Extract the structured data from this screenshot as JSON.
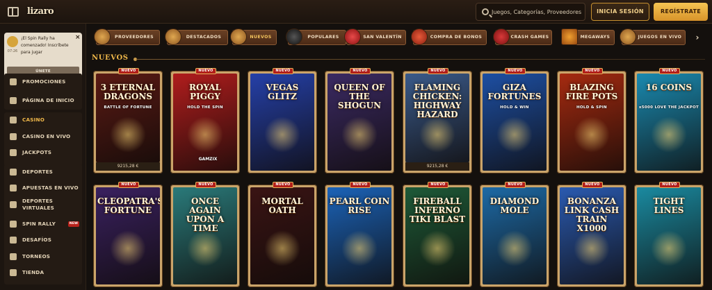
{
  "header": {
    "logo": "lizaro",
    "search_placeholder": "Juegos, Categorías, Proveedores",
    "login_label": "INICIA SESIÓN",
    "register_label": "REGÍSTRATE"
  },
  "notification": {
    "text": "¡El Spin Rally ha comenzado! Inscríbete para jugar",
    "time": "07:26",
    "button": "ÚNETE"
  },
  "sidebar": {
    "items": [
      {
        "label": "PROMOCIONES",
        "icon": "gift-icon"
      },
      {
        "label": "PÁGINA DE INICIO",
        "icon": "home-icon"
      },
      {
        "label": "CASINO",
        "icon": "casino-chip-icon"
      },
      {
        "label": "CASINO EN VIVO",
        "icon": "live-casino-icon"
      },
      {
        "label": "JACKPOTS",
        "icon": "clover-icon"
      },
      {
        "label": "DEPORTES",
        "icon": "soccer-ball-icon"
      },
      {
        "label": "APUESTAS EN VIVO",
        "icon": "play-icon"
      },
      {
        "label": "DEPORTES VIRTUALES",
        "icon": "monitor-icon"
      },
      {
        "label": "SPIN RALLY",
        "icon": "rally-icon",
        "badge": "NEW"
      },
      {
        "label": "DESAFÍOS",
        "icon": "medal-icon"
      },
      {
        "label": "TORNEOS",
        "icon": "trophy-icon"
      },
      {
        "label": "TIENDA",
        "icon": "shop-icon"
      }
    ]
  },
  "categories": [
    {
      "label": "PROVEEDORES",
      "icon": "providers-icon"
    },
    {
      "label": "DESTACADOS",
      "icon": "featured-icon"
    },
    {
      "label": "NUEVOS",
      "icon": "new-games-icon"
    },
    {
      "label": "POPULARES",
      "icon": "bomb-icon"
    },
    {
      "label": "SAN VALENTÍN",
      "icon": "heart-icon"
    },
    {
      "label": "COMPRA DE BONOS",
      "icon": "bonus-gift-icon"
    },
    {
      "label": "CRASH GAMES",
      "icon": "dynamite-icon"
    },
    {
      "label": "MEGAWAYS",
      "icon": "megaways-icon"
    },
    {
      "label": "JUEGOS EN VIVO",
      "icon": "live-games-icon"
    }
  ],
  "section": {
    "title": "NUEVOS"
  },
  "new_badge": "NUEVO",
  "games_row1": [
    {
      "title": "3 ETERNAL DRAGONS",
      "sub": "BATTLE OF FORTUNE",
      "prize": "9215,28 €",
      "bg": "#5a1a14"
    },
    {
      "title": "ROYAL PIGGY",
      "sub": "HOLD THE SPIN",
      "provider": "GAMZIX",
      "bg": "#b01d1d"
    },
    {
      "title": "VEGAS GLITZ",
      "bg": "#2540a8"
    },
    {
      "title": "QUEEN OF THE SHOGUN",
      "bg": "#3b2a63"
    },
    {
      "title": "FLAMING CHICKEN: HIGHWAY HAZARD",
      "prize": "9215,28 €",
      "bg": "#3a5a8a"
    },
    {
      "title": "GIZA FORTUNES",
      "sub": "HOLD & WIN",
      "bg": "#1d4fa3"
    },
    {
      "title": "BLAZING FIRE POTS",
      "sub": "HOLD & SPIN",
      "bg": "#a52a10"
    },
    {
      "title": "16 COINS",
      "sub": "x5000 LOVE THE JACKPOT",
      "bg": "#1a8ab0"
    }
  ],
  "games_row2": [
    {
      "title": "CLEOPATRA'S FORTUNE",
      "bg": "#3a2160"
    },
    {
      "title": "ONCE AGAIN UPON A TIME",
      "bg": "#2a7a7a"
    },
    {
      "title": "MORTAL OATH",
      "bg": "#3a1414"
    },
    {
      "title": "PEARL COIN RISE",
      "bg": "#1b63b8"
    },
    {
      "title": "FIREBALL INFERNO TIKI BLAST",
      "bg": "#1e5a38"
    },
    {
      "title": "DIAMOND MOLE",
      "bg": "#1d6aa6"
    },
    {
      "title": "BONANZA LINK CASH TRAIN X1000",
      "bg": "#2a5ab0"
    },
    {
      "title": "TIGHT LINES",
      "bg": "#1a8aa0"
    }
  ]
}
